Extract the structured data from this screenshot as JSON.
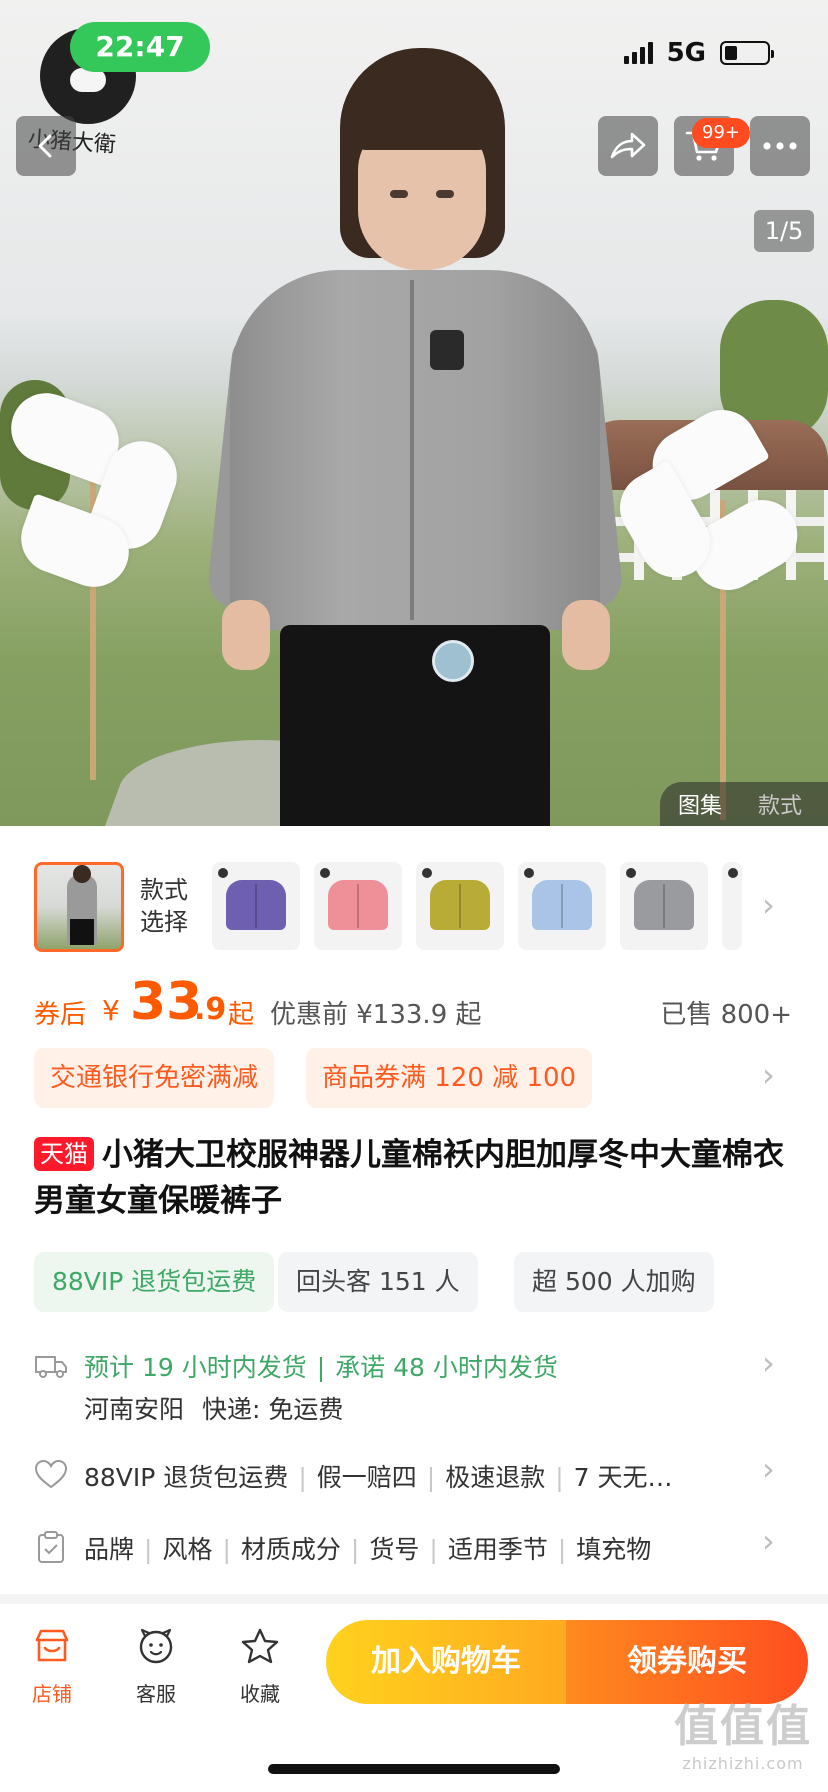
{
  "status_bar": {
    "time": "22:47",
    "network": "5G"
  },
  "hero": {
    "logo_text": "小猪大衛",
    "cart_badge": "99+",
    "image_counter": "1/5",
    "gallery_tabs": [
      "图集",
      "款式"
    ]
  },
  "variants": {
    "label": "款式选择",
    "swatch_colors": [
      "#6f5fb0",
      "#ef8f98",
      "#b8ac37",
      "#a9c4e6",
      "#9a9b9e"
    ]
  },
  "price": {
    "prefix": "券后",
    "currency": "¥",
    "integer": "33",
    "decimal": ".9",
    "suffix": "起",
    "original": "优惠前 ¥133.9 起",
    "sold": "已售 800+"
  },
  "promos": [
    "交通银行免密满减",
    "商品券满 120 减 100"
  ],
  "product": {
    "badge": "天猫",
    "title": "小猪大卫校服神器儿童棉袄内胆加厚冬中大童棉衣男童女童保暖裤子"
  },
  "tags": [
    "88VIP 退货包运费",
    "回头客 151 人",
    "超 500 人加购"
  ],
  "shipping": {
    "line1a": "预计 19 小时内发货",
    "line1b": "承诺 48 小时内发货",
    "origin": "河南安阳",
    "express": "快递: 免运费"
  },
  "guarantees": [
    "88VIP 退货包运费",
    "假一赔四",
    "极速退款",
    "7 天无…"
  ],
  "params": [
    "品牌",
    "风格",
    "材质成分",
    "货号",
    "适用季节",
    "填充物"
  ],
  "bottom_bar": {
    "store": "店铺",
    "service": "客服",
    "favorite": "收藏",
    "add_to_cart": "加入购物车",
    "buy": "领券购买"
  },
  "watermark": {
    "main": "值值值",
    "sub": "zhizhizhi.com"
  },
  "colors": {
    "accent": "#ff5a00",
    "green": "#3ea867",
    "tmall": "#ff1a2b"
  }
}
